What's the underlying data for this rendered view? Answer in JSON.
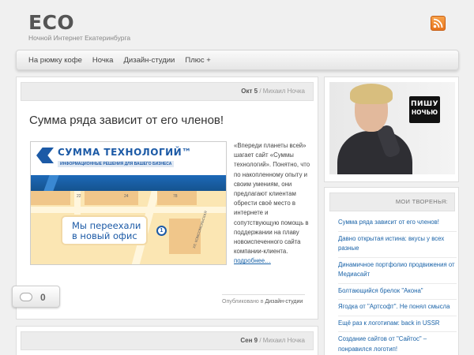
{
  "header": {
    "title": "ECO",
    "description": "Ночной Интернет Екатеринбурга",
    "rss_icon": "rss-icon"
  },
  "nav": {
    "items": [
      "На рюмку кофе",
      "Ночка",
      "Дизайн-студии",
      "Плюс +"
    ]
  },
  "post1": {
    "date": "Окт 5",
    "separator": " / ",
    "author": "Михаил Ночка",
    "title": "Сумма ряда зависит от его членов!",
    "image": {
      "logo_text": "СУММА ТЕХНОЛОГИЙ™",
      "logo_subtitle": "ИНФОРМАЦИОННЫЕ РЕШЕНИЯ ДЛЯ ВАШЕГО БИЗНЕСА",
      "callout_line1": "Мы переехали",
      "callout_line2": "в новый офис",
      "pin_number": "1",
      "map_num_22": "22",
      "map_num_24": "24",
      "map_num_78": "78",
      "street": "УЛ. КОМСОМОЛЬСКАЯ"
    },
    "excerpt": "«Впереди планеты всей» шагает сайт «Суммы технологий». Понятно, что по накопленному опыту и своим умениям, они предлагают клиентам обрести своё место в интернете и сопутствующую помощь в поддержании на плаву новоиспеченного сайта компании-клиента.",
    "read_more": "подробнее…",
    "comments": "0",
    "published_prefix": "Опубликовано в ",
    "category": "Дизайн-студии"
  },
  "post2": {
    "date": "Сен 9",
    "separator": " / ",
    "author": "Михаил Ночка"
  },
  "sidebar": {
    "sign_top": "ПИШУ",
    "sign_bottom": "НОЧЬЮ",
    "widget_title": "МОИ ТВОРЕНЬЯ:",
    "items": [
      "Сумма ряда зависит от его членов!",
      "Давно открытая истина: вкусы у всех разные",
      "Динамичное портфолио продвижения от Медиасайт",
      "Болтающийся брелок \"Акона\"",
      "Ягодка от \"Артсофт\". Не понял смысла",
      "Ещё раз к логотипам: back in USSR",
      "Создание сайтов от \"Сайтос\" – понравился логотип!"
    ]
  }
}
